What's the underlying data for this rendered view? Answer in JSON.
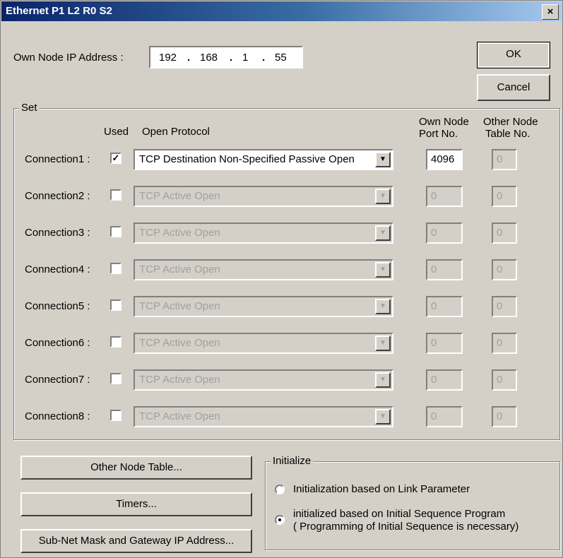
{
  "window": {
    "title": "Ethernet  P1 L2 R0 S2",
    "close_label": "×"
  },
  "ip": {
    "label": "Own Node IP Address :",
    "octets": [
      "192",
      "168",
      "1",
      "55"
    ],
    "sep": "."
  },
  "buttons": {
    "ok": "OK",
    "cancel": "Cancel"
  },
  "set": {
    "title": "Set",
    "headers": {
      "used": "Used",
      "protocol": "Open Protocol",
      "port_line1": "Own Node",
      "port_line2": "Port No.",
      "table_line1": "Other Node",
      "table_line2": "Table No."
    },
    "connections": [
      {
        "label": "Connection1 :",
        "checked_mark": "✓",
        "protocol": "TCP Destination Non-Specified Passive Open",
        "port": "4096",
        "table": "0"
      },
      {
        "label": "Connection2 :",
        "checked_mark": "",
        "protocol": "TCP Active Open",
        "port": "0",
        "table": "0"
      },
      {
        "label": "Connection3 :",
        "checked_mark": "",
        "protocol": "TCP Active Open",
        "port": "0",
        "table": "0"
      },
      {
        "label": "Connection4 :",
        "checked_mark": "",
        "protocol": "TCP Active Open",
        "port": "0",
        "table": "0"
      },
      {
        "label": "Connection5 :",
        "checked_mark": "",
        "protocol": "TCP Active Open",
        "port": "0",
        "table": "0"
      },
      {
        "label": "Connection6 :",
        "checked_mark": "",
        "protocol": "TCP Active Open",
        "port": "0",
        "table": "0"
      },
      {
        "label": "Connection7 :",
        "checked_mark": "",
        "protocol": "TCP Active Open",
        "port": "0",
        "table": "0"
      },
      {
        "label": "Connection8 :",
        "checked_mark": "",
        "protocol": "TCP Active Open",
        "port": "0",
        "table": "0"
      }
    ]
  },
  "bottom_buttons": {
    "other_node_table": "Other Node Table...",
    "timers": "Timers...",
    "subnet": "Sub-Net Mask and Gateway IP Address..."
  },
  "initialize": {
    "title": "Initialize",
    "option1": "Initialization based on Link Parameter",
    "option2_line1": "initialized based on Initial Sequence Program",
    "option2_line2": "( Programming of Initial Sequence is necessary)"
  }
}
